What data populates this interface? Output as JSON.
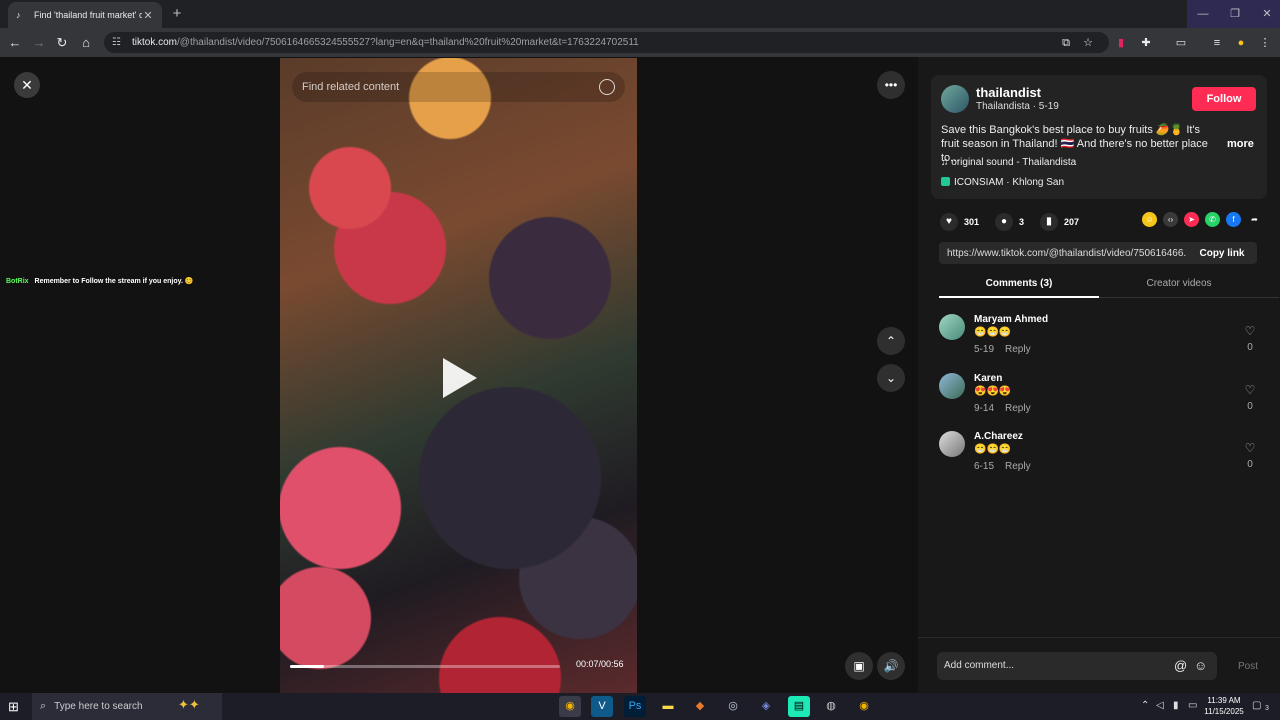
{
  "browser": {
    "tab_title": "Find 'thailand fruit market' on T",
    "url_host": "tiktok.com",
    "url_path": "/@thailandist/video/7506164665324555527?lang=en&q=thailand%20fruit%20market&t=1763224702511"
  },
  "video": {
    "search_placeholder": "Find related content",
    "time": "00:07/00:56",
    "progress": 0.125
  },
  "overlay": {
    "brand": "BotRix",
    "message": "Remember to Follow the stream if you enjoy. 😊"
  },
  "post": {
    "username": "thailandist",
    "subtitle": "Thailandista · 5-19",
    "follow_label": "Follow",
    "description": "Save this Bangkok's best place to buy fruits 🥭🍍 It's fruit season in Thailand! 🇹🇭 And there's no better place to...",
    "more_label": "more",
    "sound": "original sound - Thailandista",
    "location": "ICONSIAM · Khlong San",
    "likes": "301",
    "comments": "3",
    "saves": "207",
    "share_url": "https://www.tiktok.com/@thailandist/video/750616466...",
    "copy_label": "Copy link"
  },
  "tabs": {
    "comments": "Comments (3)",
    "creator": "Creator videos"
  },
  "comments": [
    {
      "name": "Maryam Ahmed",
      "text": "😁😁😁",
      "date": "5-19",
      "reply": "Reply",
      "likes": "0"
    },
    {
      "name": "Karen",
      "text": "😍😍😍",
      "date": "9-14",
      "reply": "Reply",
      "likes": "0"
    },
    {
      "name": "A.Chareez",
      "text": "😁😁😁",
      "date": "6-15",
      "reply": "Reply",
      "likes": "0"
    }
  ],
  "composer": {
    "placeholder": "Add comment...",
    "post_label": "Post"
  },
  "taskbar": {
    "search_placeholder": "Type here to search",
    "time": "11:39 AM",
    "date": "11/15/2025",
    "notif_count": "3"
  },
  "colors": {
    "accent": "#fe2c55",
    "background": "#121212",
    "panel": "#181818"
  }
}
